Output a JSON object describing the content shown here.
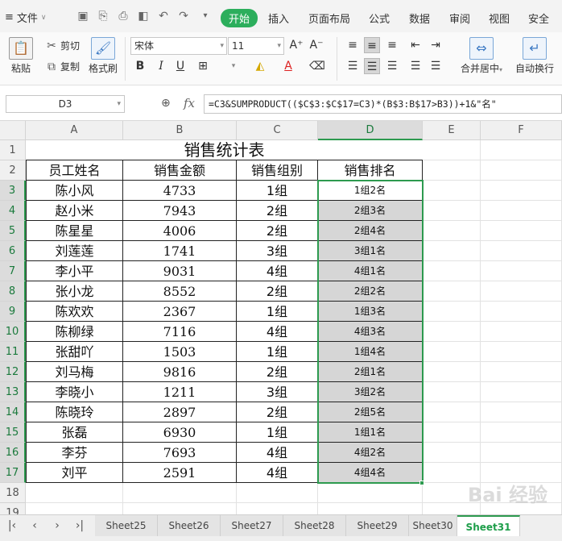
{
  "menu": {
    "file_label": "文件",
    "tabs": [
      "开始",
      "插入",
      "页面布局",
      "公式",
      "数据",
      "审阅",
      "视图",
      "安全"
    ]
  },
  "ribbon": {
    "paste": "粘贴",
    "cut": "剪切",
    "copy": "复制",
    "format_painter": "格式刷",
    "font_name": "宋体",
    "font_size": "11",
    "merge_center": "合并居中",
    "wrap_text": "自动换行"
  },
  "formula_bar": {
    "cell_ref": "D3",
    "fx": "fx",
    "formula": "=C3&SUMPRODUCT(($C$3:$C$17=C3)*(B$3:B$17>B3))+1&\"名\""
  },
  "columns": [
    "A",
    "B",
    "C",
    "D",
    "E",
    "F"
  ],
  "rows": [
    "1",
    "2",
    "3",
    "4",
    "5",
    "6",
    "7",
    "8",
    "9",
    "10",
    "11",
    "12",
    "13",
    "14",
    "15",
    "16",
    "17",
    "18",
    "19"
  ],
  "sheet": {
    "title": "销售统计表",
    "headers": [
      "员工姓名",
      "销售金额",
      "销售组别",
      "销售排名"
    ],
    "records": [
      [
        "陈小风",
        "4733",
        "1组",
        "1组2名"
      ],
      [
        "赵小米",
        "7943",
        "2组",
        "2组3名"
      ],
      [
        "陈星星",
        "4006",
        "2组",
        "2组4名"
      ],
      [
        "刘莲莲",
        "1741",
        "3组",
        "3组1名"
      ],
      [
        "李小平",
        "9031",
        "4组",
        "4组1名"
      ],
      [
        "张小龙",
        "8552",
        "2组",
        "2组2名"
      ],
      [
        "陈欢欢",
        "2367",
        "1组",
        "1组3名"
      ],
      [
        "陈柳绿",
        "7116",
        "4组",
        "4组3名"
      ],
      [
        "张甜吖",
        "1503",
        "1组",
        "1组4名"
      ],
      [
        "刘马梅",
        "9816",
        "2组",
        "2组1名"
      ],
      [
        "李晓小",
        "1211",
        "3组",
        "3组2名"
      ],
      [
        "陈晓玲",
        "2897",
        "2组",
        "2组5名"
      ],
      [
        "张磊",
        "6930",
        "1组",
        "1组1名"
      ],
      [
        "李芬",
        "7693",
        "4组",
        "4组2名"
      ],
      [
        "刘平",
        "2591",
        "4组",
        "4组4名"
      ]
    ]
  },
  "sheet_tabs": [
    "Sheet25",
    "Sheet26",
    "Sheet27",
    "Sheet28",
    "Sheet29",
    "Sheet30",
    "Sheet31"
  ],
  "active_sheet": "Sheet31",
  "watermark": "Bai 经验",
  "colors": {
    "accent": "#2d9a4f",
    "selection_fill": "#d6d6d6"
  }
}
